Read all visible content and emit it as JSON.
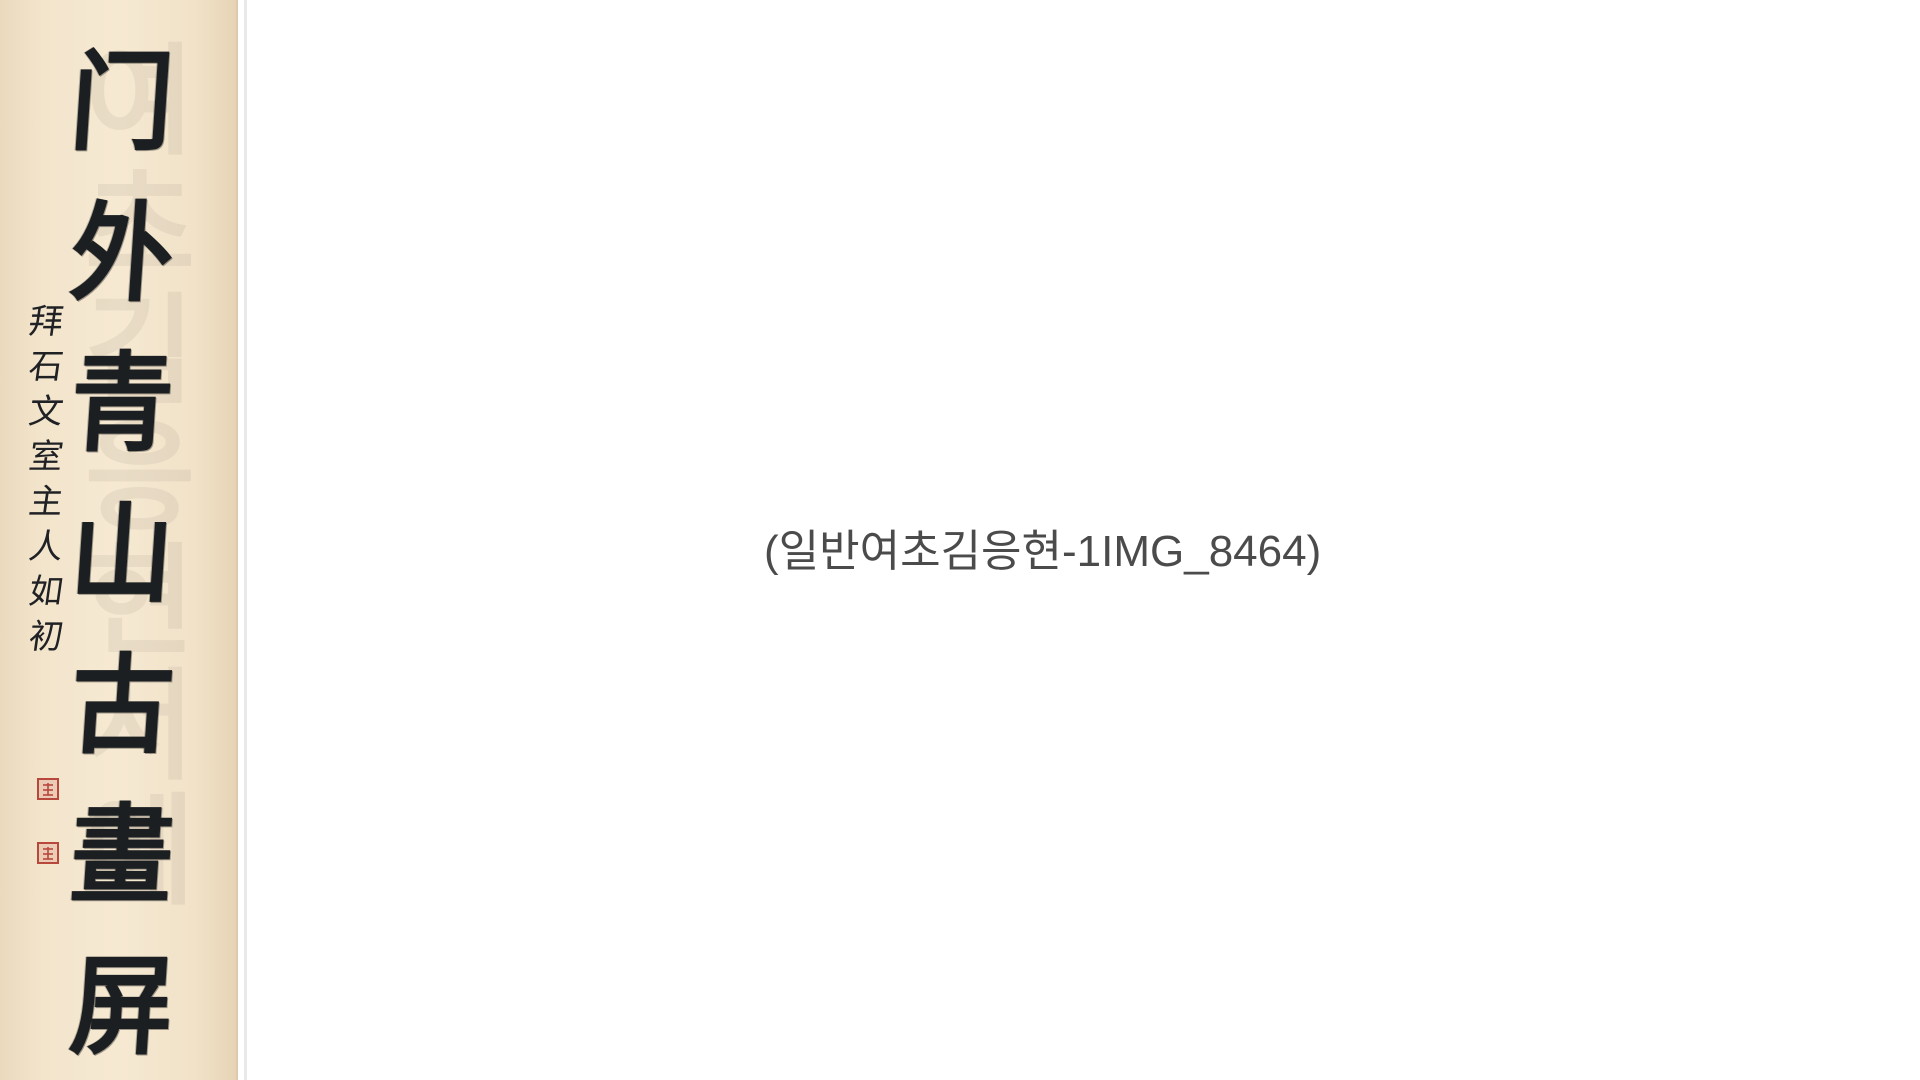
{
  "artwork": {
    "main_text": [
      "门",
      "外",
      "青",
      "山",
      "古",
      "畫",
      "屏"
    ],
    "signature_text": [
      "拜",
      "石",
      "文",
      "室",
      "主",
      "人",
      "如",
      "初"
    ],
    "watermark_text": [
      "여",
      "초",
      "김",
      "응",
      "현",
      "서",
      "예"
    ]
  },
  "caption": {
    "text": "(일반여초김응현-1IMG_8464)"
  },
  "colors": {
    "paper": "#f3e5cc",
    "ink": "#1c1f22",
    "seal": "#b8473c",
    "caption": "#4b4b4b",
    "background": "#ffffff"
  }
}
